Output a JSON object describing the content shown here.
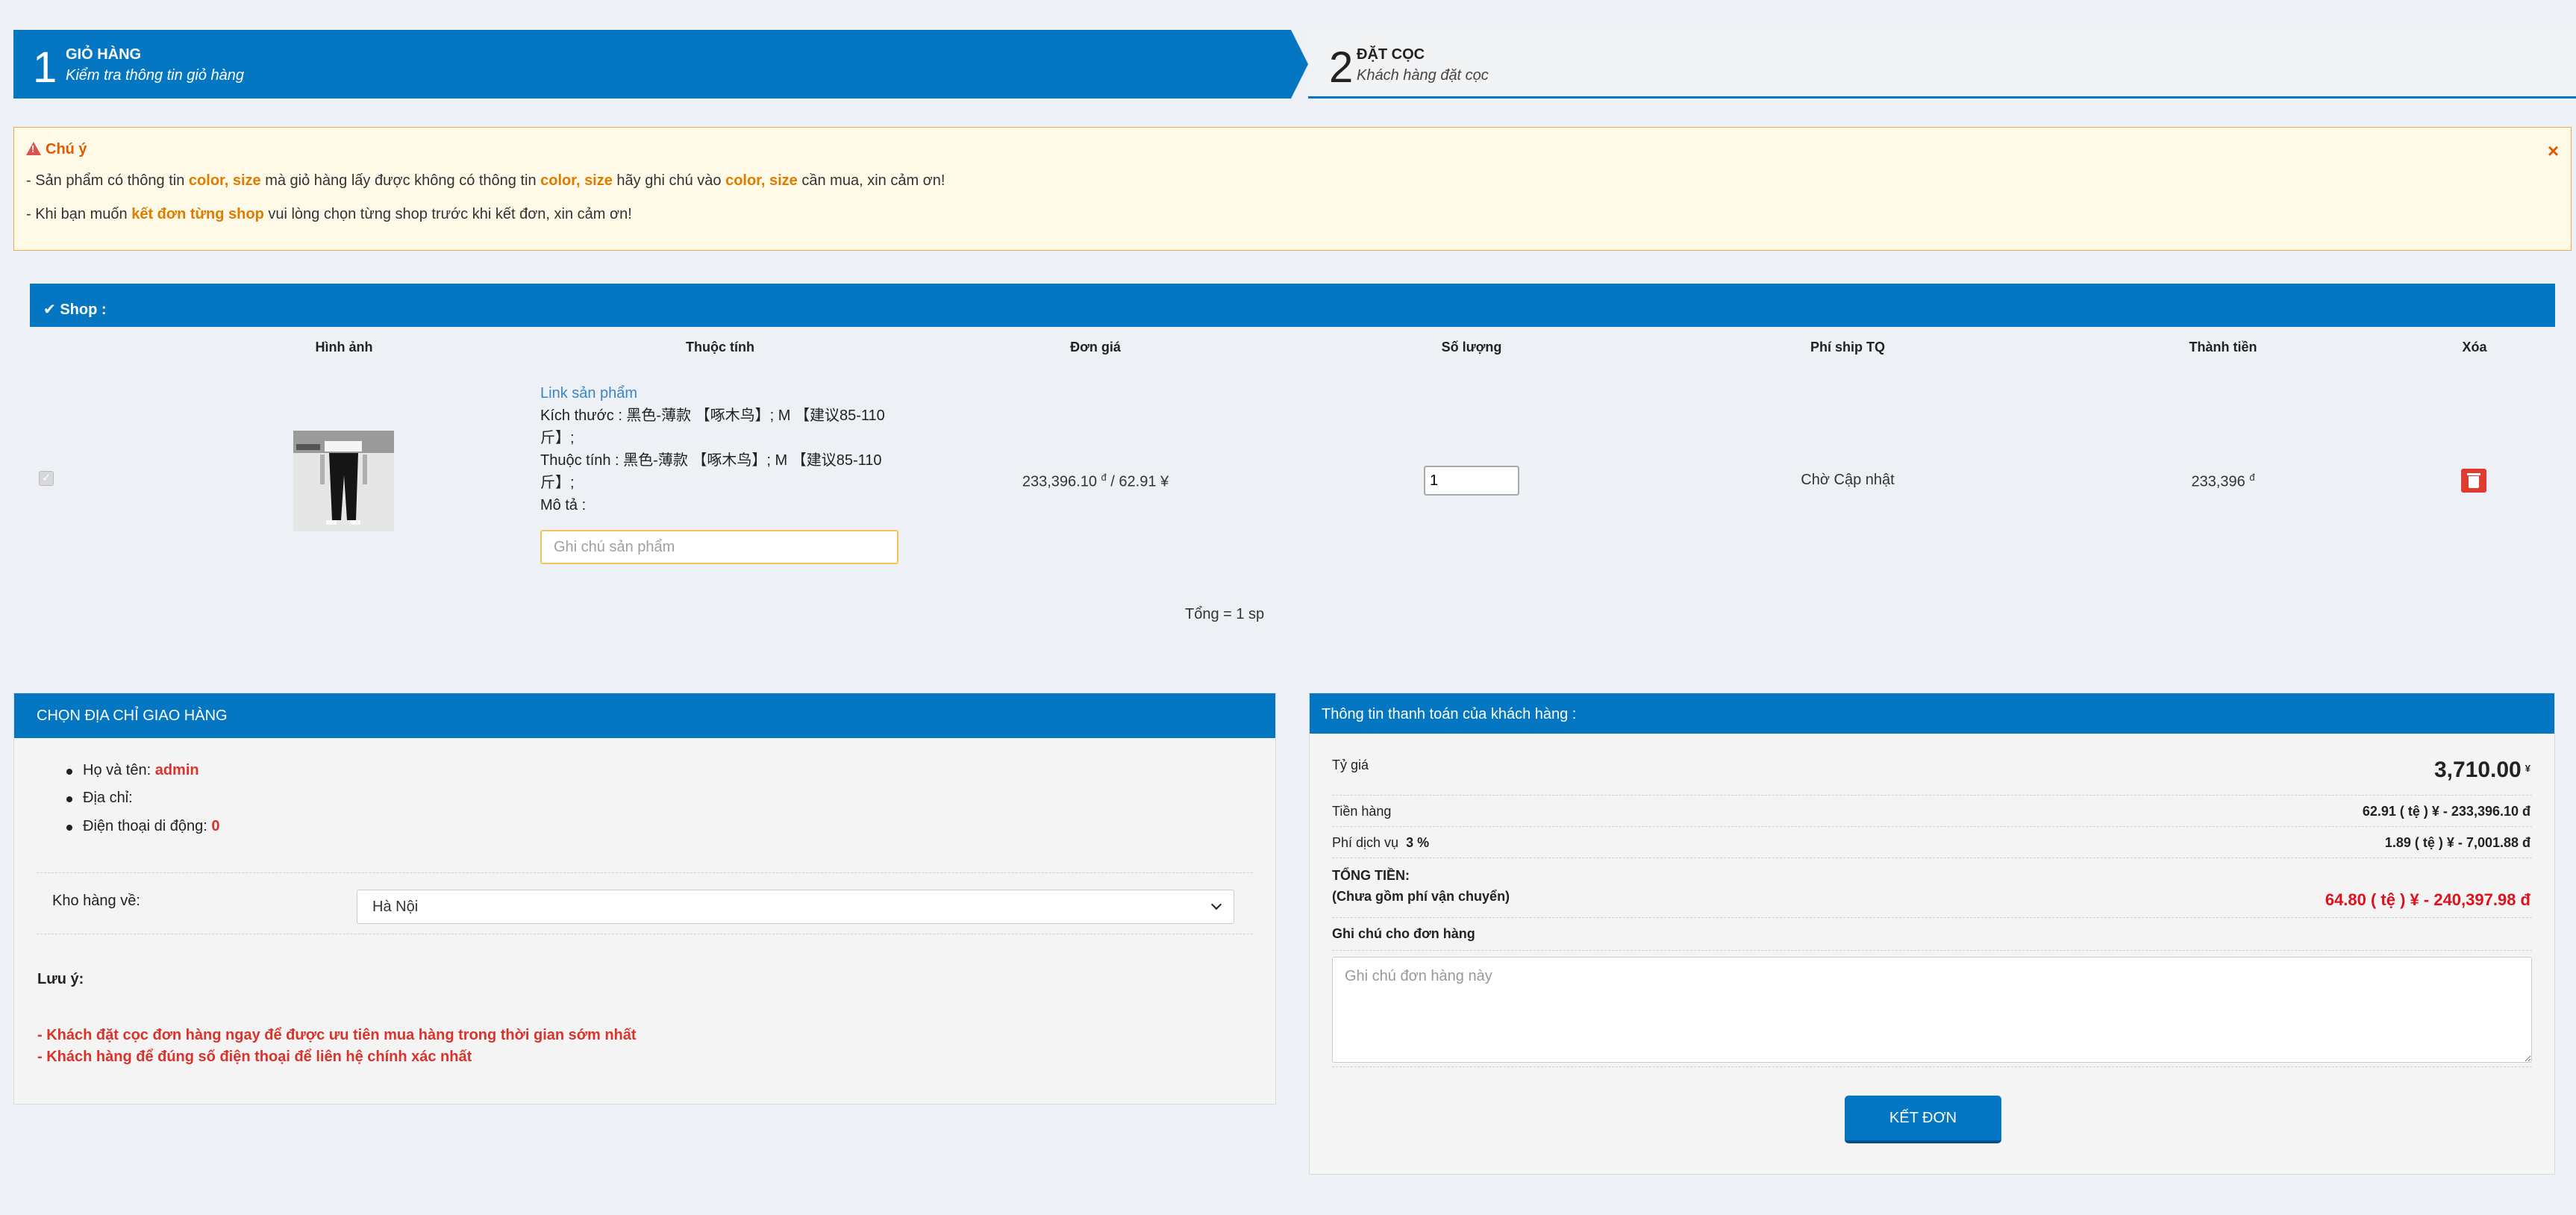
{
  "steps": [
    {
      "num": "1",
      "title": "GIỎ HÀNG",
      "subtitle": "Kiểm tra thông tin giỏ hàng"
    },
    {
      "num": "2",
      "title": "ĐẶT CỌC",
      "subtitle": "Khách hàng đặt cọc"
    }
  ],
  "notice": {
    "title": "Chú ý",
    "close": "×",
    "line1_a": "- Sản phẩm có thông tin ",
    "line1_hl1": "color, size",
    "line1_b": " mà giỏ hàng lấy được không có thông tin ",
    "line1_hl2": "color, size",
    "line1_c": " hãy ghi chú vào ",
    "line1_hl3": "color, size",
    "line1_d": " cần mua, xin cảm ơn!",
    "line2_a": "- Khi bạn muốn ",
    "line2_hl": "kết đơn từng shop",
    "line2_b": " vui lòng chọn từng shop trước khi kết đơn, xin cảm ơn!"
  },
  "shop": {
    "label": "Shop :",
    "headers": {
      "image": "Hình ảnh",
      "attributes": "Thuộc tính",
      "unit_price": "Đơn giá",
      "quantity": "Số lượng",
      "ship_fee": "Phí ship TQ",
      "subtotal": "Thành tiền",
      "delete": "Xóa"
    },
    "item": {
      "link": "Link sản phẩm",
      "size_line1": "Kích thước : 黑色-薄款 【啄木鸟】; M 【建议85-110",
      "size_line2": "斤】;",
      "attr_line1": "Thuộc tính : 黑色-薄款 【啄木鸟】; M 【建议85-110",
      "attr_line2": "斤】;",
      "desc": "Mô tả :",
      "note_placeholder": "Ghi chú sản phẩm",
      "unit_price_vnd": "233,396.10",
      "unit_price_rest": " / 62.91 ¥",
      "currency": "đ",
      "quantity": "1",
      "ship_fee": "Chờ Cập nhật",
      "subtotal": "233,396"
    },
    "total_count": "Tổng = 1 sp"
  },
  "address": {
    "header": "CHỌN ĐỊA CHỈ GIAO HÀNG",
    "name_label": "Họ và tên: ",
    "name_value": "admin",
    "addr_label": "Địa chỉ:",
    "phone_label": "Điện thoại di động: ",
    "phone_value": "0",
    "warehouse_label": "Kho hàng về:",
    "warehouse_value": "Hà Nội",
    "note_title": "Lưu ý:",
    "note_line1": "- Khách đặt cọc đơn hàng ngay để được ưu tiên mua hàng trong thời gian sớm nhất",
    "note_line2": "- Khách hàng để đúng số điện thoại để liên hệ chính xác nhất"
  },
  "payment": {
    "header": "Thông tin thanh toán của khách hàng :",
    "rate_label": "Tỷ giá",
    "rate_value": "3,710.00",
    "rate_unit": "¥",
    "goods_label": "Tiền hàng",
    "goods_value": "62.91 ( tệ ) ¥ - 233,396.10 đ",
    "service_label": "Phí dịch vụ",
    "service_pct": "3 %",
    "service_value": "1.89 ( tệ ) ¥ - 7,001.88 đ",
    "total_label": "TỔNG TIỀN:",
    "total_sub": "(Chưa gồm phí vận chuyển)",
    "total_value": "64.80 ( tệ ) ¥ - 240,397.98 đ",
    "note_label": "Ghi chú cho đơn hàng",
    "note_placeholder": "Ghi chú đơn hàng này",
    "submit": "KẾT ĐƠN"
  },
  "colors": {
    "primary": "#0577c2",
    "notice_bg": "#fffae8",
    "highlight": "#e07b00",
    "danger": "#d9332b",
    "total": "#e0111a"
  }
}
